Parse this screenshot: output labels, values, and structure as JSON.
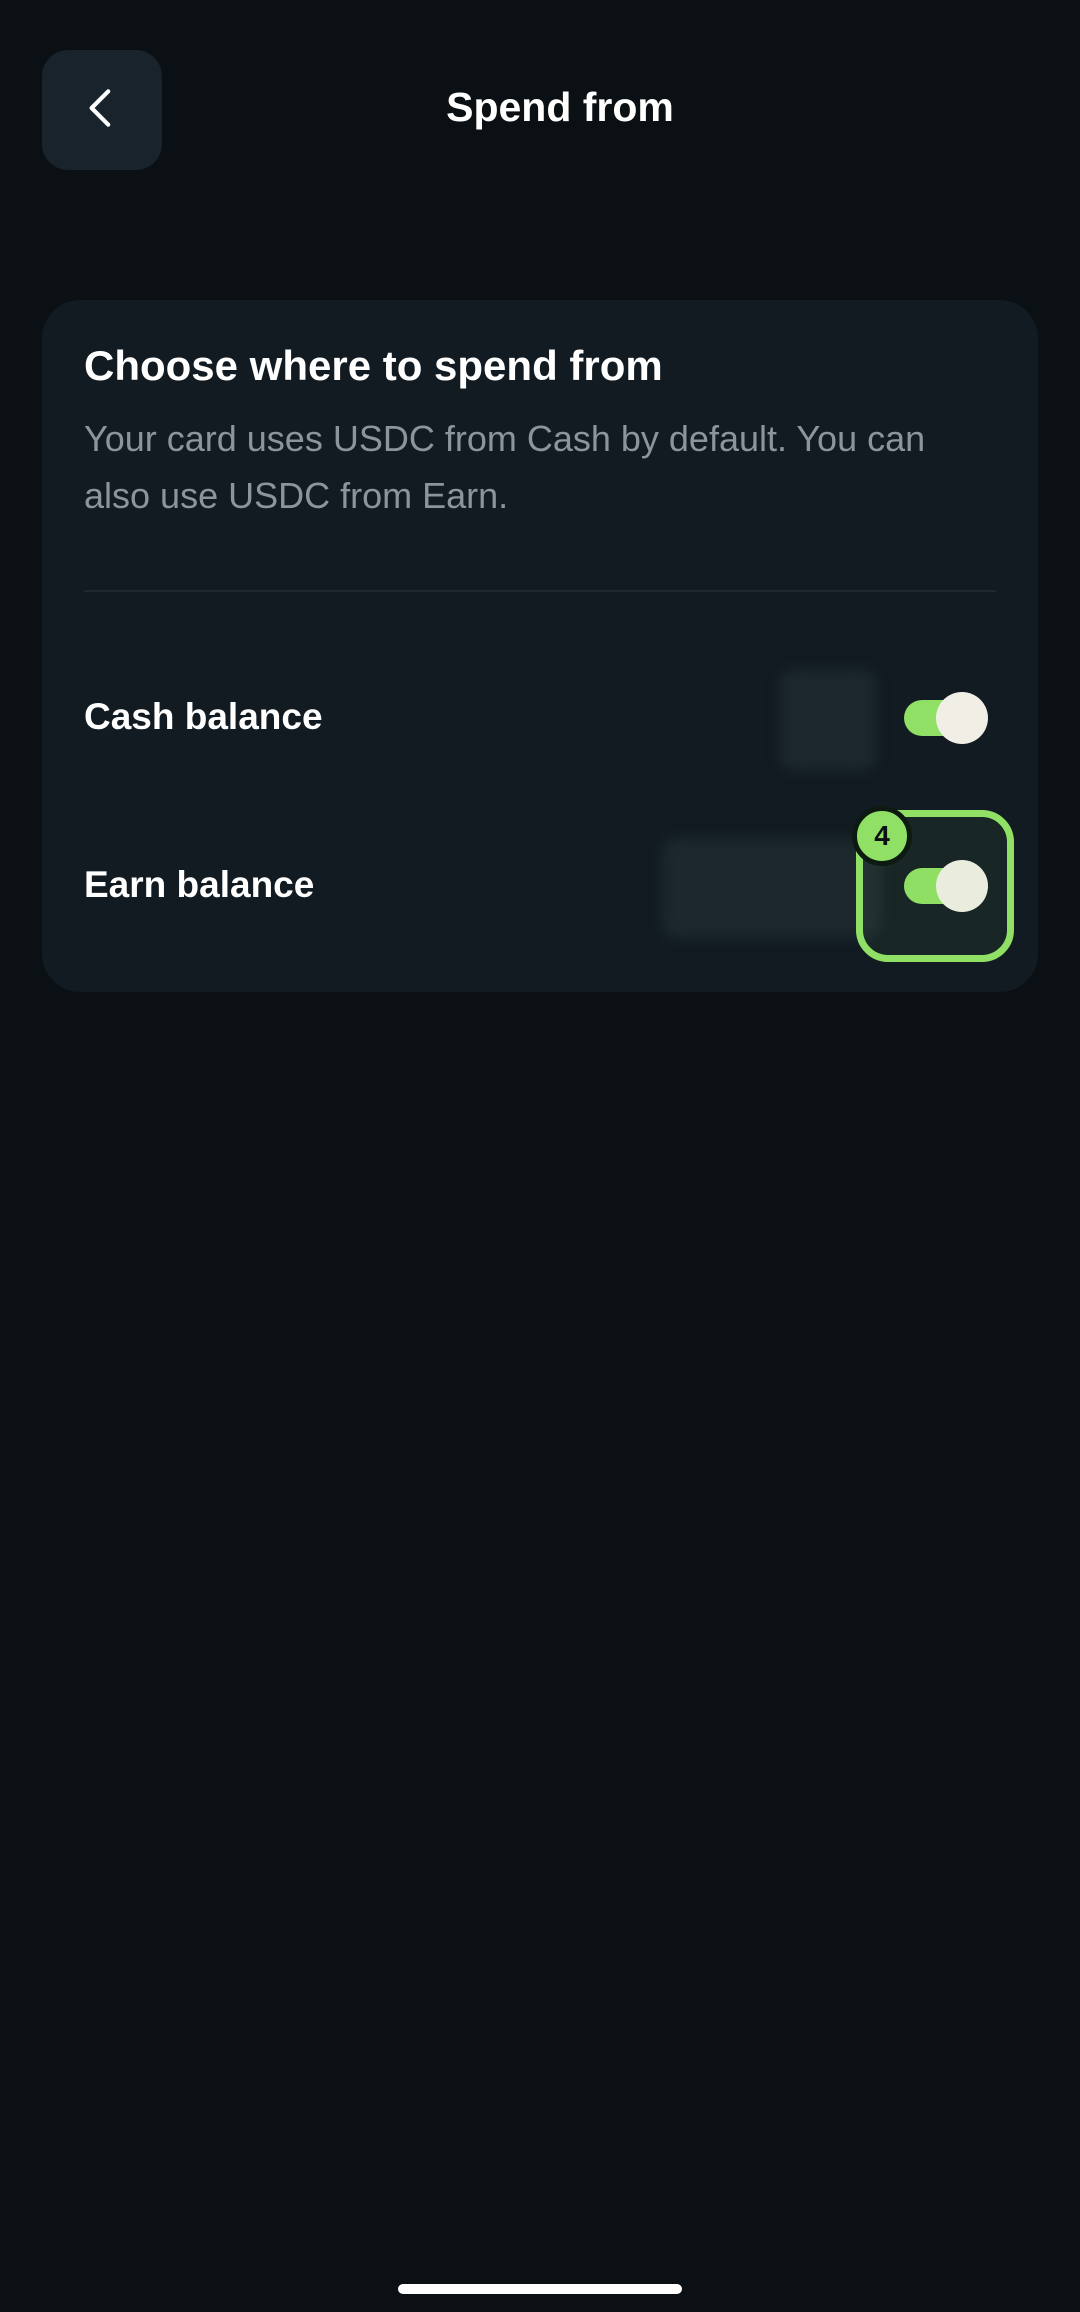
{
  "header": {
    "title": "Spend from",
    "back_icon": "chevron-left-icon"
  },
  "card": {
    "title": "Choose where to spend from",
    "description": "Your card uses USDC from Cash by default. You can also use USDC from Earn."
  },
  "rows": [
    {
      "label": "Cash balance",
      "toggle_on": true,
      "value_hidden": true
    },
    {
      "label": "Earn balance",
      "toggle_on": true,
      "value_hidden": true
    }
  ],
  "annotation": {
    "step_number": "4"
  },
  "colors": {
    "background": "#0a1013",
    "card": "#111b21",
    "accent": "#8fe064",
    "muted_text": "#8b959c"
  }
}
